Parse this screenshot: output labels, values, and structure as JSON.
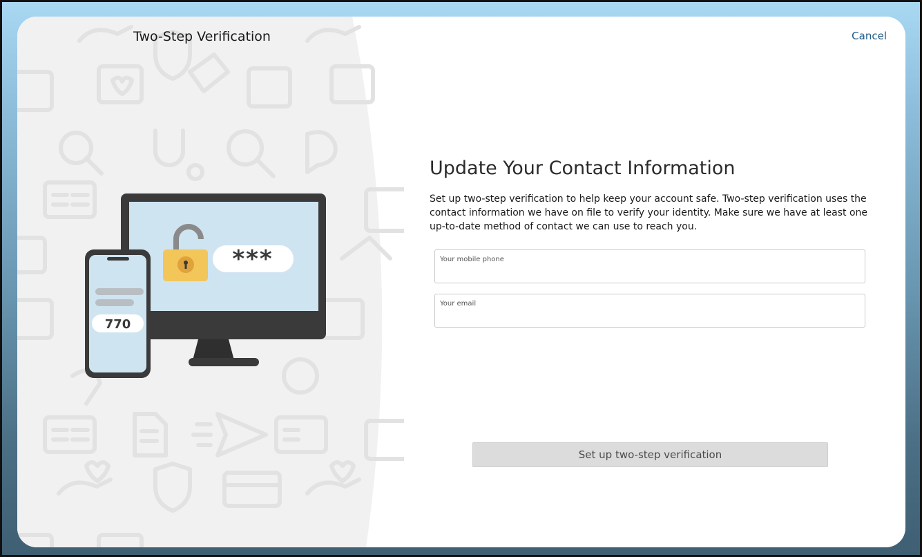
{
  "window": {
    "title": "Two-Step Verification",
    "cancel_label": "Cancel"
  },
  "content": {
    "heading": "Update Your Contact Information",
    "description": "Set up two-step verification to help keep your account safe. Two-step verification uses the contact information we have on file to verify your identity. Make sure we have at least one up-to-date method of contact we can use to reach you."
  },
  "form": {
    "phone": {
      "label": "Your mobile phone",
      "value": ""
    },
    "email": {
      "label": "Your email",
      "value": ""
    },
    "submit_label": "Set up two-step verification"
  },
  "illustration": {
    "password_mask": "***",
    "phone_code": "770"
  },
  "colors": {
    "accent_link": "#1f5a85",
    "screen_blue": "#cfe4f1",
    "lock_yellow": "#f3c65a",
    "device_dark": "#3a3a3a"
  }
}
